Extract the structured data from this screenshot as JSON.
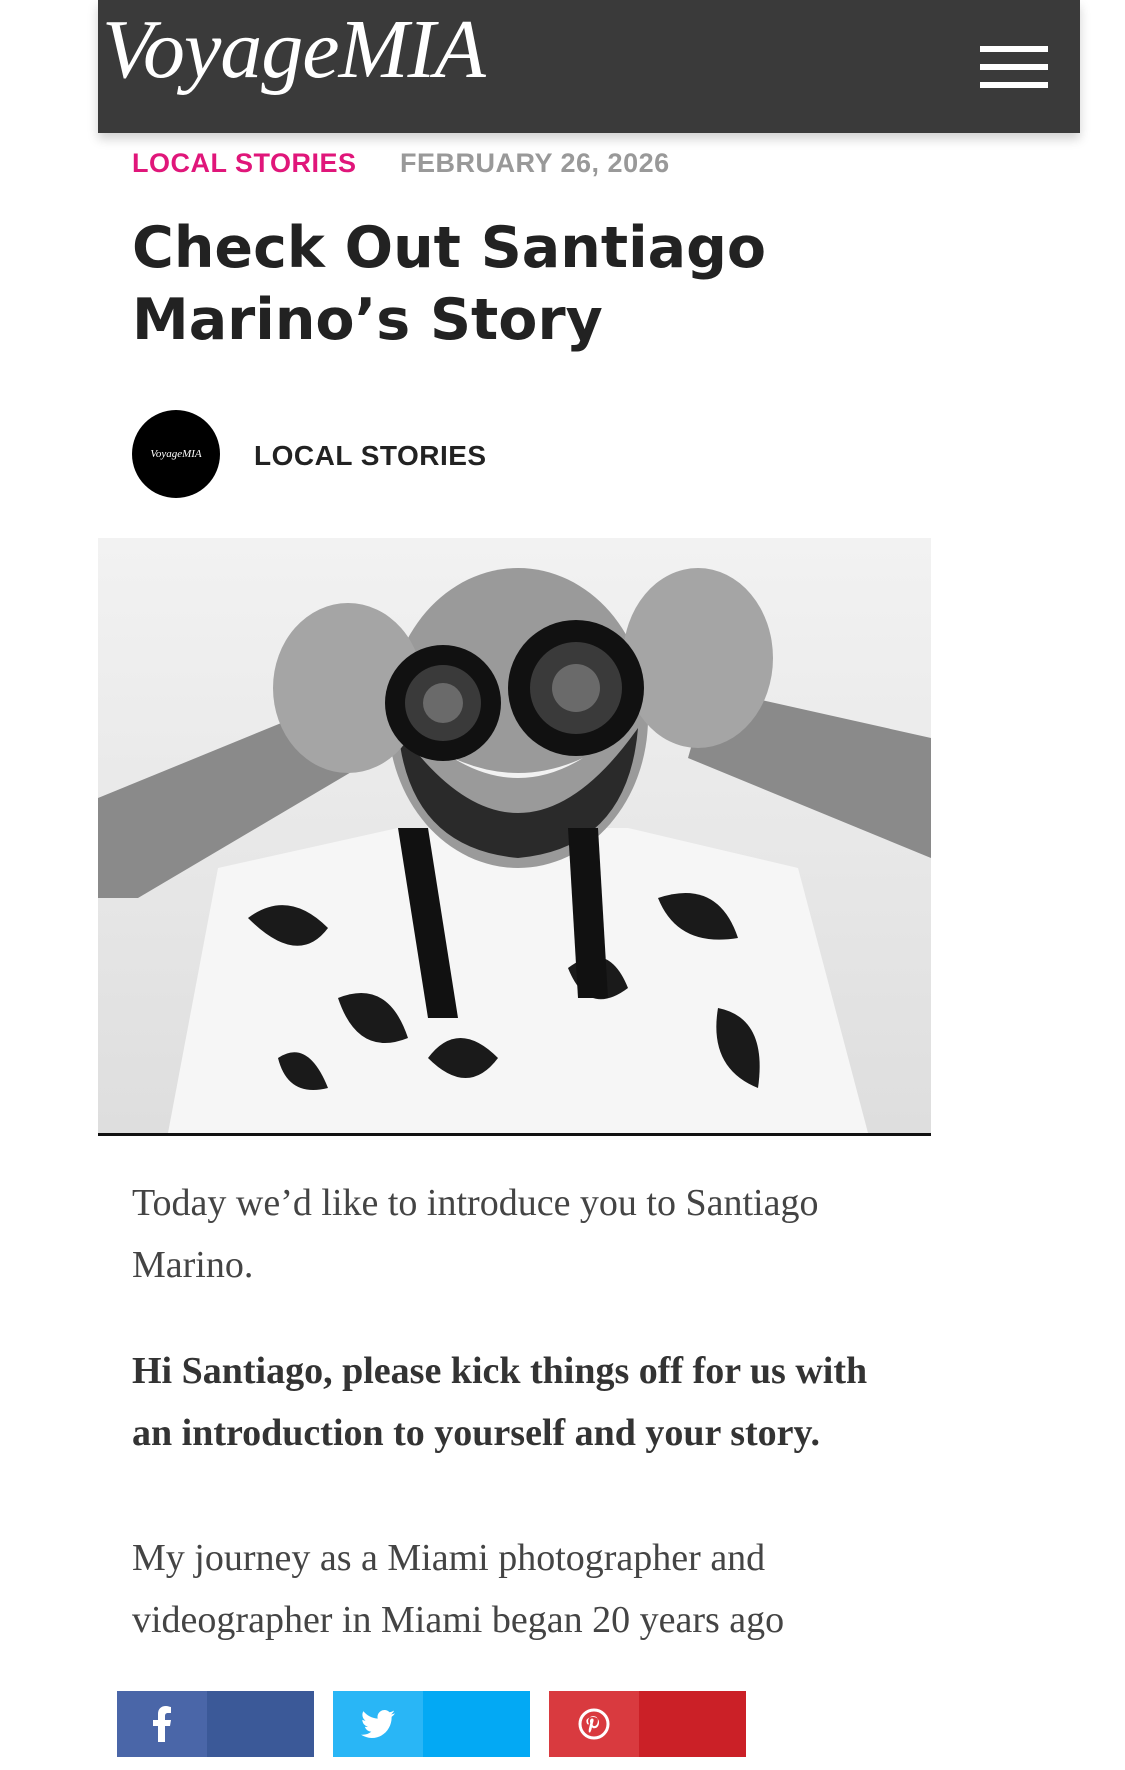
{
  "header": {
    "logo": "VoyageMIA",
    "menu_icon": "hamburger-menu-icon"
  },
  "article": {
    "category": "LOCAL STORIES",
    "date": "FEBRUARY 26, 2026",
    "title": "Check Out Santiago Marino’s Story",
    "author": {
      "avatar_text": "VoyageMIA",
      "label": "LOCAL STORIES"
    },
    "hero_image": "black-and-white photo of a smiling man holding two camera lenses over his eyes, wearing a Canon EOS R7 strap",
    "intro": "Today we’d like to introduce you to Santiago Marino.",
    "question": "Hi Santiago, please kick things off for us with an introduction to yourself and your story.",
    "answer": "My journey as a Miami photographer and videographer in Miami began 20 years ago"
  },
  "share": [
    {
      "network": "facebook",
      "icon": "facebook-icon",
      "color": "#3b5998"
    },
    {
      "network": "twitter",
      "icon": "twitter-icon",
      "color": "#03a9f4"
    },
    {
      "network": "pinterest",
      "icon": "pinterest-icon",
      "color": "#cb2027"
    }
  ],
  "colors": {
    "header_bg": "#3a3a3a",
    "category": "#e0167a",
    "date": "#999999"
  }
}
